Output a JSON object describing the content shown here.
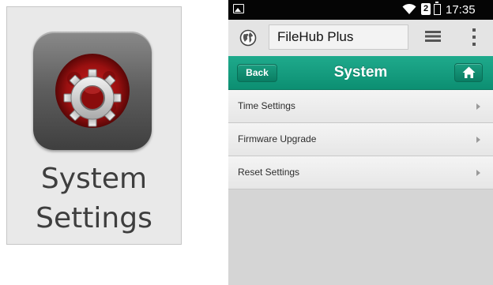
{
  "app_icon": {
    "label_line1": "System",
    "label_line2": "Settings",
    "icon": "gear-icon"
  },
  "status_bar": {
    "time": "17:35",
    "sim_label": "2",
    "icons": [
      "image-icon",
      "wifi-icon",
      "sim-icon",
      "battery-icon"
    ]
  },
  "app_bar": {
    "address": "FileHub Plus",
    "icons": [
      "globe-icon",
      "layers-icon",
      "overflow-menu-icon"
    ]
  },
  "title_bar": {
    "back_label": "Back",
    "title": "System",
    "home_icon": "home-icon"
  },
  "menu": {
    "items": [
      {
        "label": "Time Settings"
      },
      {
        "label": "Firmware Upgrade"
      },
      {
        "label": "Reset Settings"
      }
    ]
  },
  "colors": {
    "accent": "#12a080",
    "status_bar": "#050505",
    "list_background": "#d5d5d5"
  }
}
